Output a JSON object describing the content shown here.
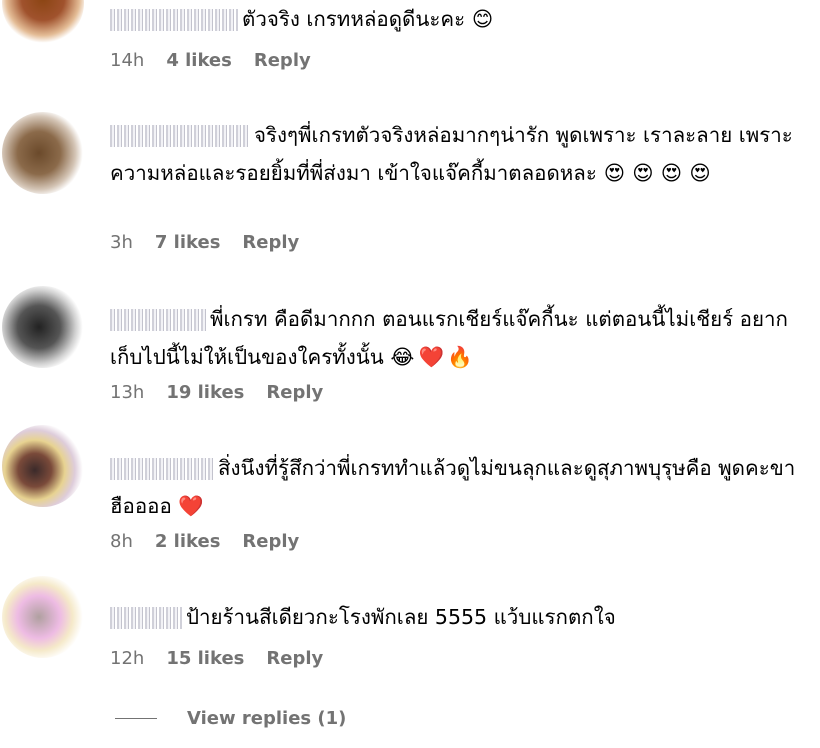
{
  "comments": [
    {
      "text": "ตัวจริง เกรทหล่อดูดีนะคะ",
      "emojis": [
        "😊"
      ],
      "time": "14h",
      "likes": "4 likes",
      "reply": "Reply"
    },
    {
      "text": "จริงๆพี่เกรทตัวจริงหล่อมากๆน่ารัก พูดเพราะ เราละลาย เพราะความหล่อและรอยยิ้มที่พี่ส่งมา เข้าใจแจ๊คกี้มาตลอดหละ",
      "emojis": [
        "😍",
        "😍",
        "😍",
        "😍"
      ],
      "time": "3h",
      "likes": "7 likes",
      "reply": "Reply"
    },
    {
      "text": "พี่เกรท คือดีมากกก ตอนแรกเชียร์แจ๊คกี้นะ แต่ตอนนี้ไม่เชียร์ อยากเก็บไปนี้ไม่ให้เป็นของใครทั้งนั้น",
      "emojis": [
        "😂",
        "❤️",
        "🔥"
      ],
      "time": "13h",
      "likes": "19 likes",
      "reply": "Reply"
    },
    {
      "text": "สิ่งนึงที่รู้สึกว่าพี่เกรททำแล้วดูไม่ขนลุกและดูสุภาพบุรุษคือ พูดคะขา ฮืออออ",
      "emojis": [
        "❤️"
      ],
      "time": "8h",
      "likes": "2 likes",
      "reply": "Reply"
    },
    {
      "text": "ป้ายร้านสีเดียวกะโรงพักเลย 5555 แว้บแรกตกใจ",
      "emojis": [],
      "time": "12h",
      "likes": "15 likes",
      "reply": "Reply"
    }
  ],
  "view_replies": "View replies (1)"
}
